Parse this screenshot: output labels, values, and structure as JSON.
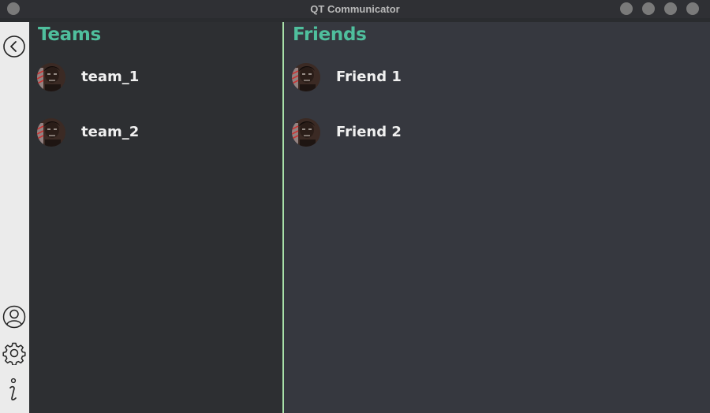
{
  "window": {
    "title": "QT Communicator"
  },
  "rail": {
    "icons": [
      "back-icon",
      "profile-icon",
      "settings-icon",
      "info-icon"
    ]
  },
  "teams": {
    "title": "Teams",
    "items": [
      {
        "label": "team_1"
      },
      {
        "label": "team_2"
      }
    ]
  },
  "friends": {
    "title": "Friends",
    "items": [
      {
        "label": "Friend 1"
      },
      {
        "label": "Friend 2"
      }
    ]
  },
  "colors": {
    "accent": "#4fbf9d",
    "divider": "#a8e0a9",
    "teams_bg": "#2d2f32",
    "friends_bg": "#36383f",
    "rail_bg": "#ebebeb"
  }
}
